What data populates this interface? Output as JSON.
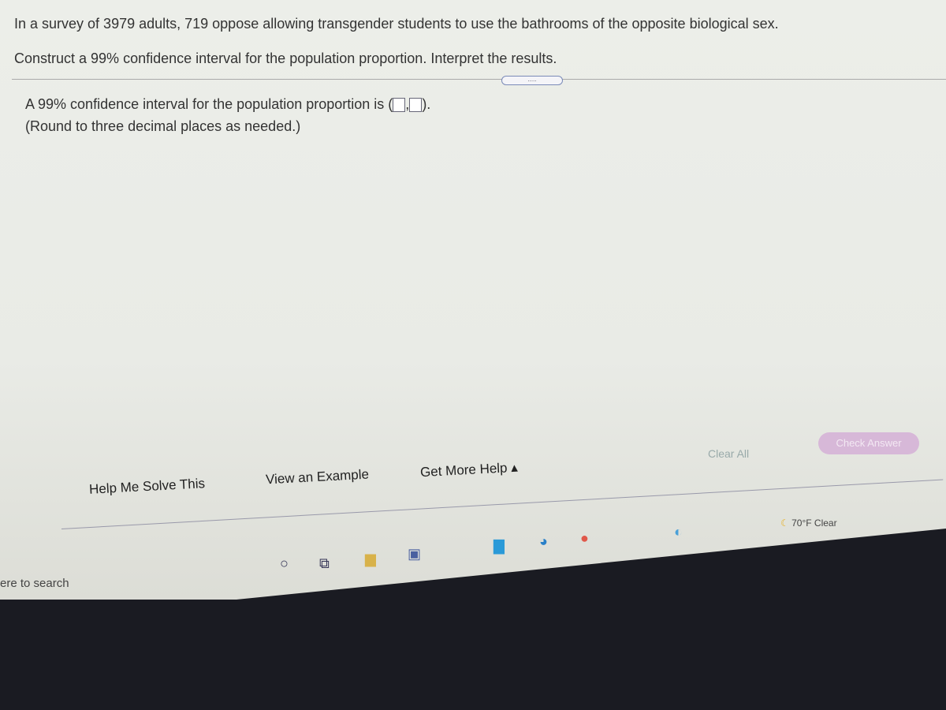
{
  "question": {
    "line1": "In a survey of 3979 adults, 719 oppose allowing transgender students to use the bathrooms of the opposite biological sex.",
    "line2": "Construct a 99% confidence interval for the population proportion. Interpret the results.",
    "more": "....."
  },
  "answer": {
    "prefix": "A 99% confidence interval for the population proportion is (",
    "sep": ",",
    "suffix": ").",
    "note": "(Round to three decimal places as needed.)"
  },
  "help": {
    "solve": "Help Me Solve This",
    "example": "View an Example",
    "more": "Get More Help ▴"
  },
  "actions": {
    "clear": "Clear All",
    "check": "Check Answer"
  },
  "taskbar": {
    "search": "ere to search",
    "weather": "70°F  Clear"
  }
}
